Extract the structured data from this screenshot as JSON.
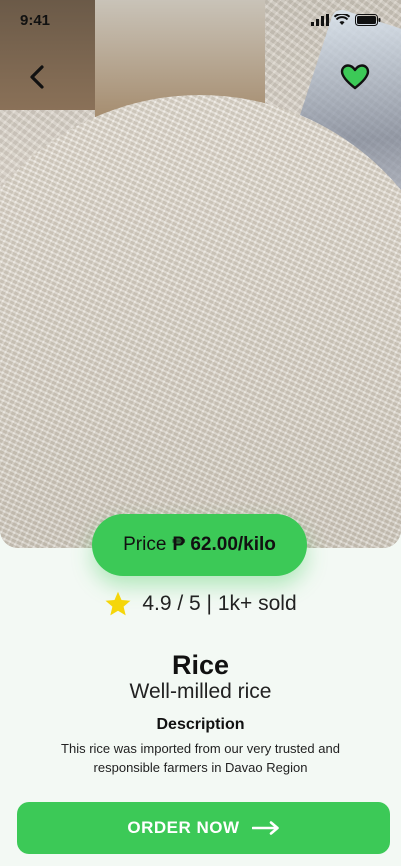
{
  "status_bar": {
    "time": "9:41"
  },
  "product": {
    "name": "Rice",
    "variety": "Well-milled rice",
    "price_label": "Price",
    "price_value": "₱ 62.00/kilo",
    "rating_text": "4.9 / 5 | 1k+ sold",
    "description_heading": "Description",
    "description": "This rice was imported from our very trusted and responsible farmers in Davao Region"
  },
  "actions": {
    "order_label": "ORDER NOW"
  },
  "icons": {
    "back": "back-arrow-icon",
    "favorite": "heart-icon",
    "star": "star-icon",
    "order_arrow": "arrow-right-icon"
  },
  "colors": {
    "accent": "#3cc957",
    "star": "#f5d60a",
    "heart_outline": "#111111"
  }
}
